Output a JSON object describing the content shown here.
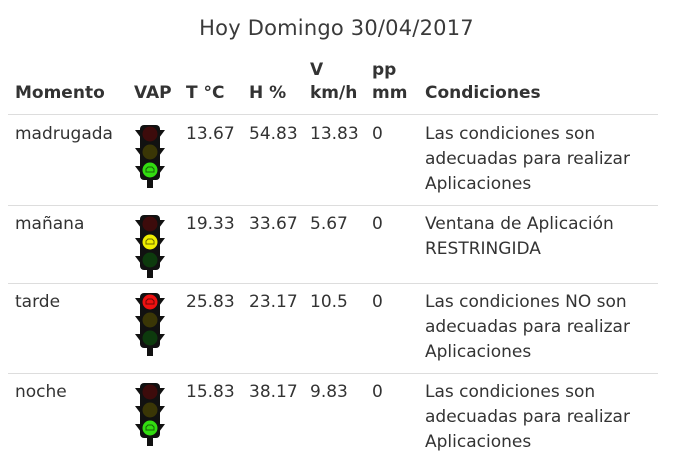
{
  "title": "Hoy Domingo 30/04/2017",
  "headers": {
    "momento": "Momento",
    "vap": "VAP",
    "temp": "T °C",
    "hum": "H %",
    "wind_1": "V",
    "wind_2": "km/h",
    "precip_1": "pp",
    "precip_2": "mm",
    "condiciones": "Condiciones"
  },
  "colors": {
    "green_on": "#33dd11",
    "yellow_on": "#eeee00",
    "red_on": "#ee1111",
    "lamp_off_red": "#3d0b0b",
    "lamp_off_yellow": "#3a3606",
    "lamp_off_green": "#0d3a0d",
    "housing": "#111111",
    "divider": "#dddddd"
  },
  "rows": [
    {
      "momento": "madrugada",
      "vap_state": "green",
      "vap_icon": "traffic-light-green",
      "temp": "13.67",
      "hum": "54.83",
      "wind": "13.83",
      "pp": "0",
      "condiciones": "Las condiciones son adecuadas para realizar Aplicaciones"
    },
    {
      "momento": "mañana",
      "vap_state": "yellow",
      "vap_icon": "traffic-light-yellow",
      "temp": "19.33",
      "hum": "33.67",
      "wind": "5.67",
      "pp": "0",
      "condiciones": "Ventana de Aplicación RESTRINGIDA"
    },
    {
      "momento": "tarde",
      "vap_state": "red",
      "vap_icon": "traffic-light-red",
      "temp": "25.83",
      "hum": "23.17",
      "wind": "10.5",
      "pp": "0",
      "condiciones": "Las condiciones NO son adecuadas para realizar Aplicaciones"
    },
    {
      "momento": "noche",
      "vap_state": "green",
      "vap_icon": "traffic-light-green",
      "temp": "15.83",
      "hum": "38.17",
      "wind": "9.83",
      "pp": "0",
      "condiciones": "Las condiciones son adecuadas para realizar Aplicaciones"
    }
  ]
}
